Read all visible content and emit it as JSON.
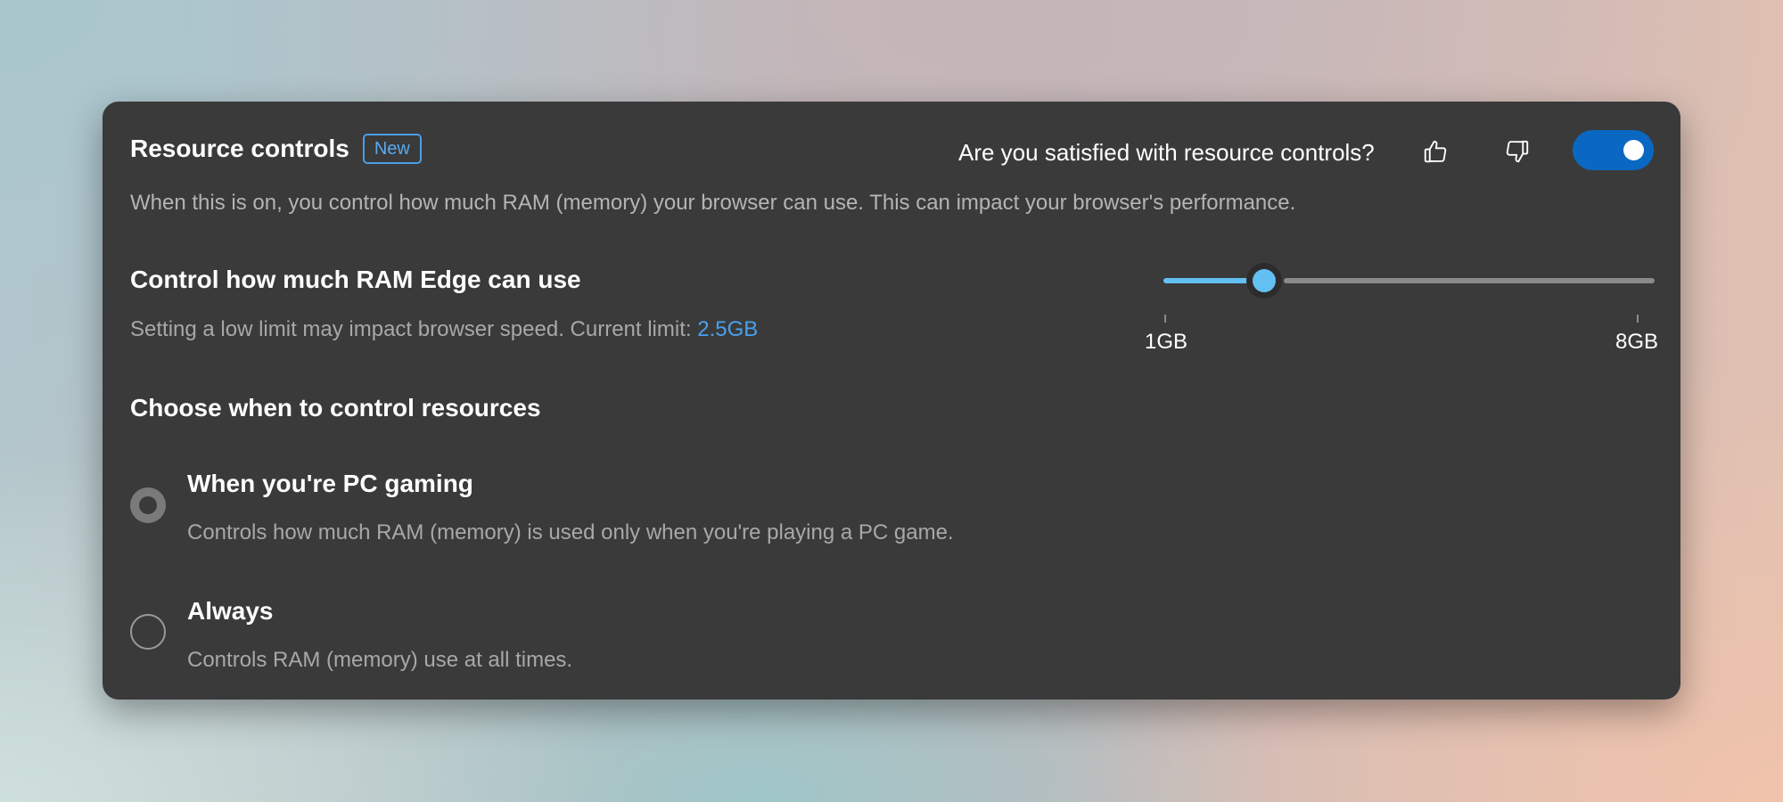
{
  "header": {
    "title": "Resource controls",
    "badge": "New",
    "feedback_question": "Are you satisfied with resource controls?",
    "thumbs_up_icon": "thumbs-up-icon",
    "thumbs_down_icon": "thumbs-down-icon",
    "toggle_on": true
  },
  "description": "When this is on, you control how much RAM (memory) your browser can use. This can impact your browser's performance.",
  "ram": {
    "heading": "Control how much RAM Edge can use",
    "subtext": "Setting a low limit may impact browser speed. Current limit: ",
    "current_limit": "2.5GB",
    "slider_min_label": "1GB",
    "slider_max_label": "8GB",
    "slider_value_gb": 2.5
  },
  "mode": {
    "heading": "Choose when to control resources",
    "options": [
      {
        "label": "When you're PC gaming",
        "description": "Controls how much RAM (memory) is used only when you're playing a PC game.",
        "selected": true
      },
      {
        "label": "Always",
        "description": "Controls RAM (memory) use at all times.",
        "selected": false
      }
    ]
  },
  "colors": {
    "card_background": "#3a3a3a",
    "accent_blue": "#0a68c2",
    "slider_blue": "#62c0f2",
    "link_blue": "#4aa0ee"
  }
}
